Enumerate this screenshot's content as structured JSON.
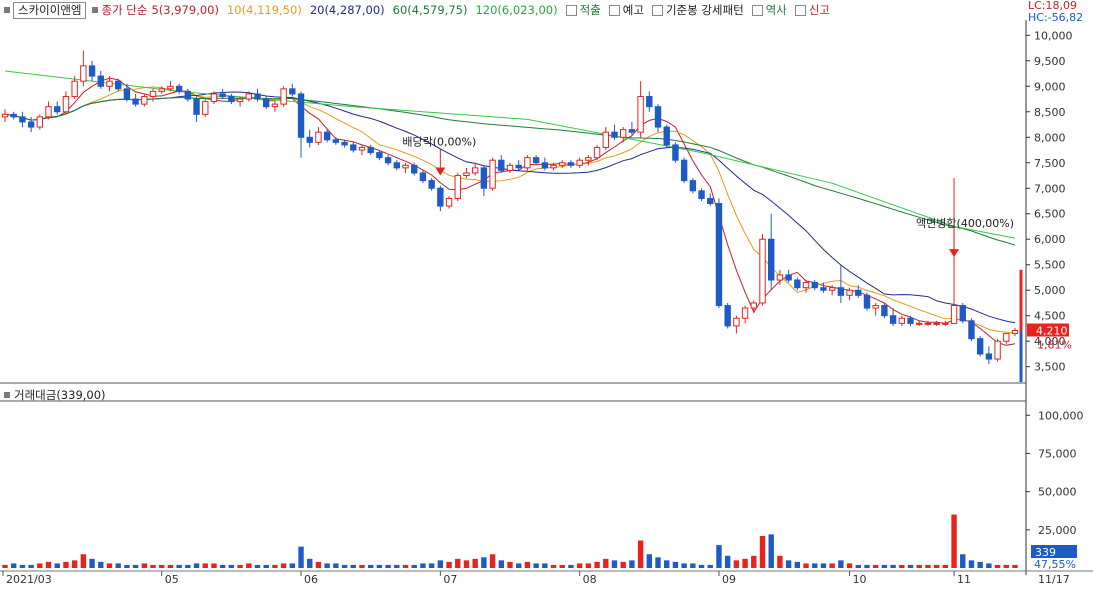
{
  "header": {
    "stock_name": "스카이이앤엠",
    "ma_label": "종가 단순",
    "ma5": "5(3,979,00)",
    "ma10": "10(4,119,50)",
    "ma20": "20(4,287,00)",
    "ma60": "60(4,579,75)",
    "ma120": "120(6,023,00)",
    "opt_accumulate": "적출",
    "opt_forecast": "예고",
    "opt_pattern": "기준봉 강세패턴",
    "opt_reverse": "역사",
    "opt_newhigh": "신고",
    "lc": "LC:18,09",
    "hc": "HC:-56,82"
  },
  "colors": {
    "up": "#e8231f",
    "down": "#1e5bc6",
    "ma5": "#c0212b",
    "ma10": "#e99a1c",
    "ma20": "#1e2a8c",
    "ma60": "#1f7a3a",
    "ma120": "#35c74b"
  },
  "annotations": {
    "dividend": "배당락(0,00%)",
    "split": "액면병합(400,00%)"
  },
  "price_axis": {
    "ticks": [
      "10,000",
      "9,500",
      "9,000",
      "8,500",
      "8,000",
      "7,500",
      "7,000",
      "6,500",
      "6,000",
      "5,500",
      "5,000",
      "4,500",
      "4,000",
      "3,500"
    ],
    "current_price": "4,210",
    "change_pct": "1,81%"
  },
  "volume_panel": {
    "title": "거래대금(339,00)",
    "ticks": [
      "100,000",
      "75,000",
      "50,000",
      "25,000"
    ],
    "current_value": "339",
    "ratio_pct": "47,55%"
  },
  "x_axis": {
    "labels": [
      "2021/03",
      "05",
      "06",
      "07",
      "08",
      "09",
      "10",
      "11"
    ],
    "last_date": "11/17"
  },
  "chart_data": {
    "type": "candlestick",
    "price_range": [
      3200,
      10300
    ],
    "volume_range": [
      0,
      110000
    ],
    "ohlc": [
      [
        8400,
        8550,
        8300,
        8450
      ],
      [
        8450,
        8500,
        8350,
        8400
      ],
      [
        8400,
        8500,
        8200,
        8300
      ],
      [
        8300,
        8400,
        8100,
        8200
      ],
      [
        8200,
        8450,
        8150,
        8400
      ],
      [
        8400,
        8700,
        8350,
        8600
      ],
      [
        8600,
        8700,
        8450,
        8500
      ],
      [
        8500,
        8900,
        8450,
        8800
      ],
      [
        8800,
        9200,
        8750,
        9100
      ],
      [
        9100,
        9700,
        9000,
        9400
      ],
      [
        9400,
        9500,
        9100,
        9200
      ],
      [
        9200,
        9300,
        8950,
        9000
      ],
      [
        9000,
        9200,
        8900,
        9100
      ],
      [
        9100,
        9150,
        8900,
        8950
      ],
      [
        8950,
        9050,
        8700,
        8750
      ],
      [
        8750,
        8850,
        8600,
        8650
      ],
      [
        8650,
        8850,
        8600,
        8800
      ],
      [
        8800,
        8950,
        8700,
        8900
      ],
      [
        8900,
        9000,
        8850,
        8950
      ],
      [
        8950,
        9100,
        8900,
        9000
      ],
      [
        9000,
        9050,
        8850,
        8900
      ],
      [
        8900,
        8950,
        8700,
        8750
      ],
      [
        8750,
        8800,
        8300,
        8450
      ],
      [
        8450,
        8750,
        8400,
        8700
      ],
      [
        8700,
        8900,
        8650,
        8850
      ],
      [
        8850,
        8950,
        8750,
        8800
      ],
      [
        8800,
        8850,
        8650,
        8700
      ],
      [
        8700,
        8800,
        8600,
        8750
      ],
      [
        8750,
        8900,
        8700,
        8850
      ],
      [
        8850,
        8950,
        8700,
        8750
      ],
      [
        8750,
        8800,
        8550,
        8600
      ],
      [
        8600,
        8700,
        8500,
        8650
      ],
      [
        8650,
        9000,
        8600,
        8950
      ],
      [
        8950,
        9050,
        8800,
        8850
      ],
      [
        8850,
        8900,
        7600,
        8000
      ],
      [
        8000,
        8150,
        7800,
        7900
      ],
      [
        7900,
        8200,
        7850,
        8100
      ],
      [
        8100,
        8150,
        7900,
        7950
      ],
      [
        7950,
        8000,
        7850,
        7900
      ],
      [
        7900,
        7950,
        7800,
        7850
      ],
      [
        7850,
        7900,
        7700,
        7750
      ],
      [
        7750,
        7850,
        7650,
        7800
      ],
      [
        7800,
        7850,
        7650,
        7700
      ],
      [
        7700,
        7750,
        7550,
        7600
      ],
      [
        7600,
        7650,
        7450,
        7500
      ],
      [
        7500,
        7550,
        7350,
        7400
      ],
      [
        7400,
        7500,
        7300,
        7450
      ],
      [
        7450,
        7500,
        7250,
        7300
      ],
      [
        7300,
        7350,
        7100,
        7150
      ],
      [
        7150,
        7200,
        6950,
        7000
      ],
      [
        7000,
        7050,
        6550,
        6650
      ],
      [
        6650,
        6850,
        6600,
        6800
      ],
      [
        6800,
        7300,
        6750,
        7250
      ],
      [
        7250,
        7400,
        7200,
        7300
      ],
      [
        7300,
        7500,
        7250,
        7400
      ],
      [
        7400,
        7450,
        6850,
        7000
      ],
      [
        7000,
        7600,
        6950,
        7550
      ],
      [
        7550,
        7650,
        7300,
        7350
      ],
      [
        7350,
        7500,
        7300,
        7450
      ],
      [
        7450,
        7550,
        7350,
        7400
      ],
      [
        7400,
        7650,
        7350,
        7600
      ],
      [
        7600,
        7650,
        7450,
        7500
      ],
      [
        7500,
        7600,
        7350,
        7400
      ],
      [
        7400,
        7500,
        7350,
        7450
      ],
      [
        7450,
        7550,
        7400,
        7500
      ],
      [
        7500,
        7550,
        7400,
        7450
      ],
      [
        7450,
        7600,
        7400,
        7550
      ],
      [
        7550,
        7650,
        7450,
        7600
      ],
      [
        7600,
        7850,
        7550,
        7800
      ],
      [
        7800,
        8200,
        7750,
        8100
      ],
      [
        8100,
        8250,
        7950,
        8000
      ],
      [
        8000,
        8200,
        7900,
        8150
      ],
      [
        8150,
        8300,
        8050,
        8100
      ],
      [
        8100,
        9100,
        8000,
        8800
      ],
      [
        8800,
        8900,
        8500,
        8600
      ],
      [
        8600,
        8650,
        8100,
        8200
      ],
      [
        8200,
        8250,
        7800,
        7850
      ],
      [
        7850,
        7900,
        7500,
        7550
      ],
      [
        7550,
        7600,
        7100,
        7150
      ],
      [
        7150,
        7200,
        6900,
        6950
      ],
      [
        6950,
        7000,
        6750,
        6800
      ],
      [
        6800,
        6900,
        6650,
        6700
      ],
      [
        6700,
        6800,
        4650,
        4700
      ],
      [
        4700,
        4750,
        4250,
        4300
      ],
      [
        4300,
        4500,
        4150,
        4450
      ],
      [
        4450,
        4700,
        4350,
        4650
      ],
      [
        4650,
        4800,
        4550,
        4750
      ],
      [
        4750,
        6100,
        4700,
        6000
      ],
      [
        6000,
        6500,
        5000,
        5200
      ],
      [
        5200,
        5400,
        5100,
        5300
      ],
      [
        5300,
        5400,
        5150,
        5200
      ],
      [
        5200,
        5250,
        5000,
        5050
      ],
      [
        5050,
        5200,
        4950,
        5150
      ],
      [
        5150,
        5200,
        5000,
        5050
      ],
      [
        5050,
        5150,
        4950,
        5000
      ],
      [
        5000,
        5100,
        4900,
        5050
      ],
      [
        5050,
        5500,
        4750,
        4900
      ],
      [
        4900,
        5050,
        4800,
        5000
      ],
      [
        5000,
        5100,
        4850,
        4900
      ],
      [
        4900,
        4950,
        4600,
        4650
      ],
      [
        4650,
        4750,
        4500,
        4700
      ],
      [
        4700,
        4750,
        4450,
        4500
      ],
      [
        4500,
        4650,
        4300,
        4350
      ],
      [
        4350,
        4500,
        4300,
        4450
      ],
      [
        4450,
        4500,
        4300,
        4350
      ],
      [
        4350,
        4400,
        4300,
        4350
      ],
      [
        4350,
        4400,
        4300,
        4350
      ],
      [
        4350,
        4400,
        4300,
        4350
      ],
      [
        4350,
        4400,
        4300,
        4350
      ],
      [
        4350,
        7200,
        4350,
        4700
      ],
      [
        4700,
        4750,
        4350,
        4400
      ],
      [
        4400,
        4450,
        4000,
        4050
      ],
      [
        4050,
        4100,
        3700,
        3750
      ],
      [
        3750,
        3900,
        3550,
        3650
      ],
      [
        3650,
        4050,
        3600,
        4000
      ],
      [
        4000,
        4150,
        3950,
        4150
      ],
      [
        4150,
        4260,
        4100,
        4210
      ]
    ],
    "volume": [
      2,
      3,
      2,
      2,
      3,
      4,
      3,
      4,
      5,
      9,
      6,
      4,
      3,
      3,
      2,
      2,
      3,
      2,
      2,
      2,
      2,
      2,
      3,
      3,
      3,
      2,
      2,
      2,
      3,
      2,
      2,
      2,
      3,
      3,
      14,
      6,
      4,
      3,
      3,
      2,
      2,
      2,
      2,
      2,
      2,
      2,
      2,
      2,
      3,
      3,
      5,
      4,
      6,
      5,
      6,
      7,
      9,
      5,
      4,
      3,
      4,
      3,
      3,
      2,
      2,
      2,
      3,
      3,
      4,
      6,
      5,
      4,
      5,
      18,
      9,
      7,
      5,
      4,
      3,
      3,
      2,
      2,
      15,
      8,
      5,
      6,
      8,
      21,
      22,
      8,
      5,
      4,
      3,
      3,
      3,
      3,
      5,
      3,
      2,
      2,
      2,
      2,
      2,
      2,
      2,
      2,
      2,
      2,
      2,
      35,
      9,
      5,
      4,
      3,
      2,
      2,
      2
    ],
    "markers": [
      {
        "label": "배당락(0,00%)",
        "index": 50,
        "price": 7250
      },
      {
        "label": "액면병합(400,00%)",
        "index": 109,
        "price": 5650
      }
    ]
  }
}
